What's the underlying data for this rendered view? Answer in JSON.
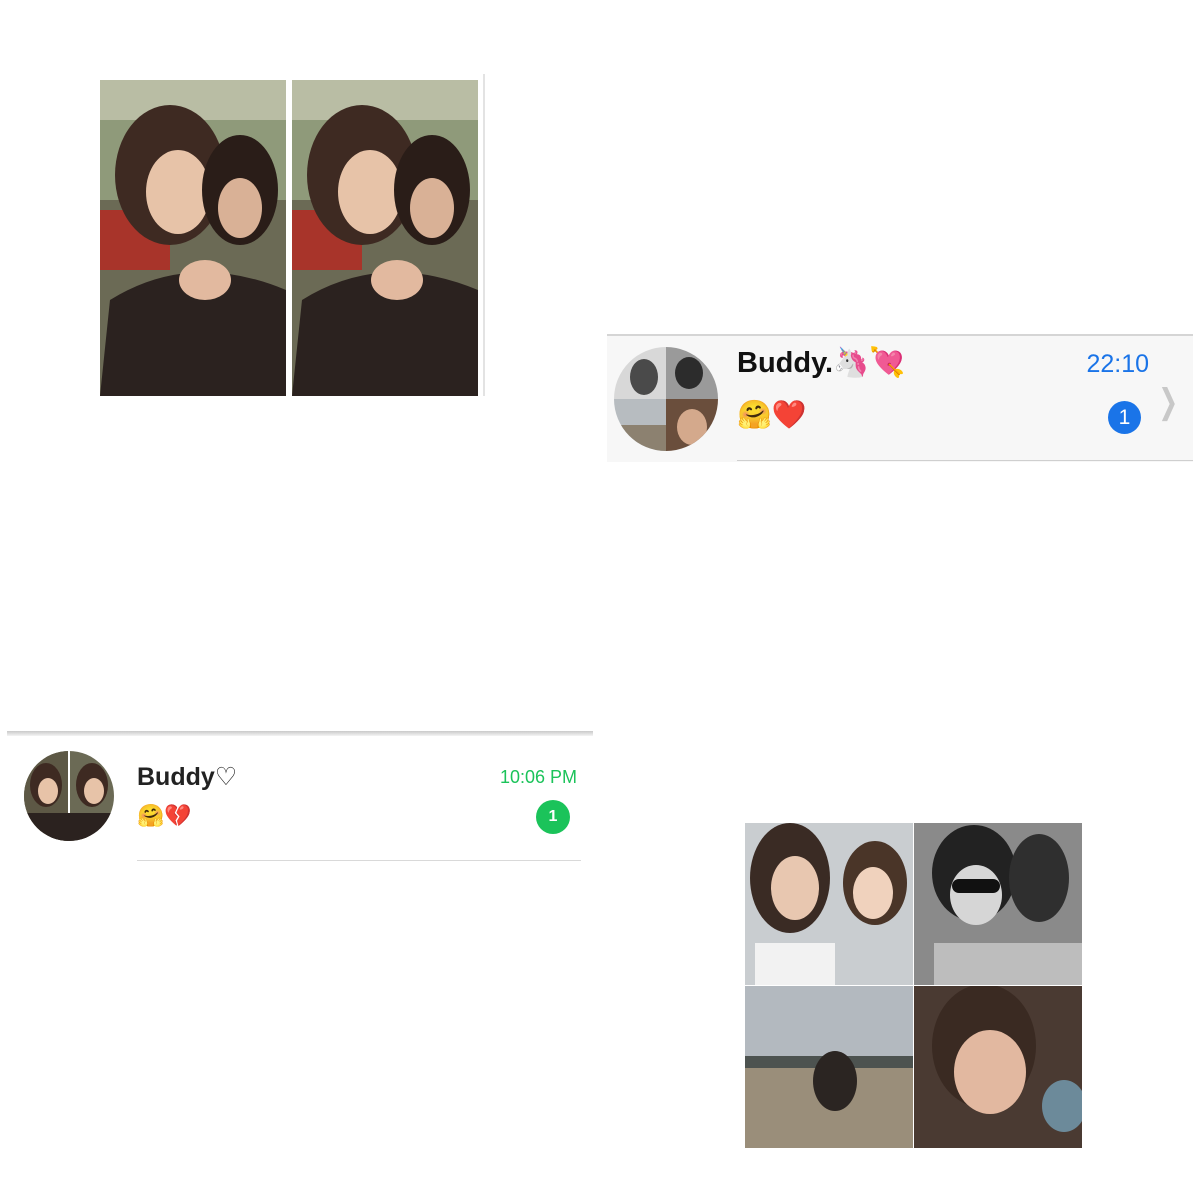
{
  "top_left_photo": {
    "alt": "two people hugging, side-by-side duplicate photo strip"
  },
  "ios_chat_row": {
    "contact_name": "Buddy.🦄💘",
    "time": "22:10",
    "preview": "🤗❤️",
    "unread_count": "1",
    "accent_color": "#1a74e8",
    "avatar_icon": "collage-avatar"
  },
  "whatsapp_chat_row": {
    "contact_name": "Buddy♡",
    "time": "10:06 PM",
    "preview": "🤗💔",
    "unread_count": "1",
    "accent_color": "#1bc35a",
    "avatar_icon": "photo-avatar"
  },
  "bottom_right_collage": {
    "alt": "four-photo collage"
  }
}
